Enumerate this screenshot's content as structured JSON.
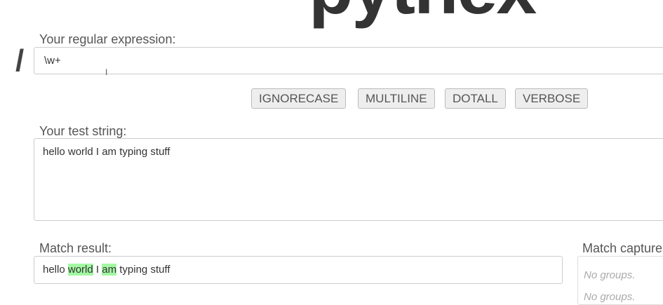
{
  "logo": "pythex",
  "regex": {
    "label": "Your regular expression:",
    "delimiter": "/",
    "value": "\\w+"
  },
  "flags": [
    "IGNORECASE",
    "MULTILINE",
    "DOTALL",
    "VERBOSE"
  ],
  "test": {
    "label": "Your test string:",
    "value": "hello world I am typing stuff"
  },
  "result": {
    "label": "Match result:",
    "segments": [
      "hello ",
      "world",
      " I ",
      "am",
      " typing stuff"
    ]
  },
  "captures": {
    "label": "Match captures:",
    "items": [
      "No groups.",
      "No groups."
    ]
  }
}
